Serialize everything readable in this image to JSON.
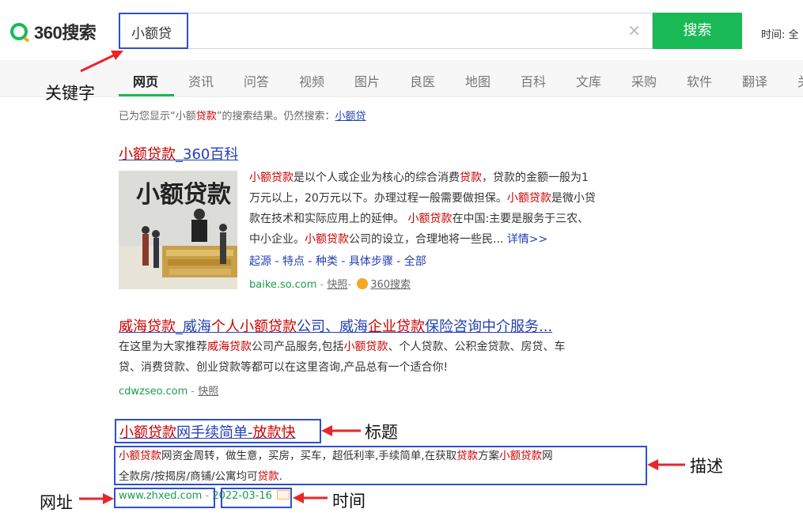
{
  "header": {
    "logo_text": "360搜索",
    "query": "小额贷",
    "clear_symbol": "×",
    "search_button": "搜索",
    "time_filter": "时间: 全"
  },
  "nav": {
    "tabs": [
      "网页",
      "资讯",
      "问答",
      "视频",
      "图片",
      "良医",
      "地图",
      "百科",
      "文库",
      "采购",
      "软件",
      "翻译",
      "关"
    ],
    "active": "网页"
  },
  "notice": {
    "prefix": "已为您显示“小额",
    "kw": "贷款",
    "mid": "”的搜索结果。仍然搜索：",
    "link": "小额贷"
  },
  "results": [
    {
      "title_hl": "小额贷款",
      "title_rest": "_360百科",
      "desc_lines": [
        [
          [
            "小额贷款",
            "hl"
          ],
          [
            "是以个人或企业为核心的综合消费",
            ""
          ],
          [
            "贷款",
            "hl"
          ],
          [
            "，贷款的金额一般为1",
            ""
          ]
        ],
        [
          [
            "万元以上，20万元以下。办理过程一般需要做担保。",
            ""
          ],
          [
            "小额贷款",
            "hl"
          ],
          [
            "是微小贷",
            ""
          ]
        ],
        [
          [
            "款在技术和实际应用上的延伸。 ",
            ""
          ],
          [
            "小额贷款",
            "hl"
          ],
          [
            "在中国:主要是服务于三农、",
            ""
          ]
        ],
        [
          [
            "中小企业。",
            ""
          ],
          [
            "小额贷款",
            "hl"
          ],
          [
            "公司的设立，合理地将一些民... ",
            ""
          ],
          [
            "详情>>",
            "more"
          ]
        ]
      ],
      "sublinks": "起源 - 特点 - 种类 - 具体步骤 - 全部",
      "url": "baike.so.com",
      "kuaizhao": "快照",
      "source": "360搜索",
      "image_text": "小额贷款"
    },
    {
      "title_parts": [
        [
          "威海贷款",
          "hl"
        ],
        [
          "_威海",
          ""
        ],
        [
          "个人小额贷款",
          "hl"
        ],
        [
          "公司、威海",
          ""
        ],
        [
          "企业贷款",
          "hl"
        ],
        [
          "保险咨询中介服务...",
          ""
        ]
      ],
      "desc_lines": [
        [
          [
            "在这里为大家推荐",
            ""
          ],
          [
            "威海贷款",
            "hl"
          ],
          [
            "公司产品服务,包括",
            ""
          ],
          [
            "小额贷款",
            "hl"
          ],
          [
            "、个人贷款、公积金贷款、房贷、车",
            ""
          ]
        ],
        [
          [
            "贷、消费贷款、创业贷款等都可以在这里咨询,产品总有一个适合你!",
            ""
          ]
        ]
      ],
      "url": "cdwzseo.com",
      "kuaizhao": "快照"
    },
    {
      "title_parts": [
        [
          "小额贷款",
          "hl"
        ],
        [
          "网手续简单-",
          ""
        ],
        [
          "放款快",
          "hl"
        ]
      ],
      "desc_lines": [
        [
          [
            "小额贷款",
            "hl"
          ],
          [
            "网资金周转，做生意，买房，买车，超低利率,手续简单,在获取",
            ""
          ],
          [
            "贷款",
            "hl"
          ],
          [
            "方案",
            ""
          ],
          [
            "小额贷款",
            "hl"
          ],
          [
            "网",
            ""
          ]
        ],
        [
          [
            "全款房/按揭房/商铺/公寓均可",
            ""
          ],
          [
            "贷款",
            "hl"
          ],
          [
            ".",
            ""
          ]
        ]
      ],
      "url": "www.zhxed.com",
      "date": "2022-03-16"
    }
  ],
  "annotations": {
    "keyword": "关键字",
    "title": "标题",
    "description": "描述",
    "url": "网址",
    "time": "时间"
  },
  "colors": {
    "brand_green": "#19b955",
    "annotation_blue": "#2e4fcf",
    "arrow_red": "#e8262a",
    "link_blue": "#2440b3",
    "highlight_red": "#cc0000"
  }
}
